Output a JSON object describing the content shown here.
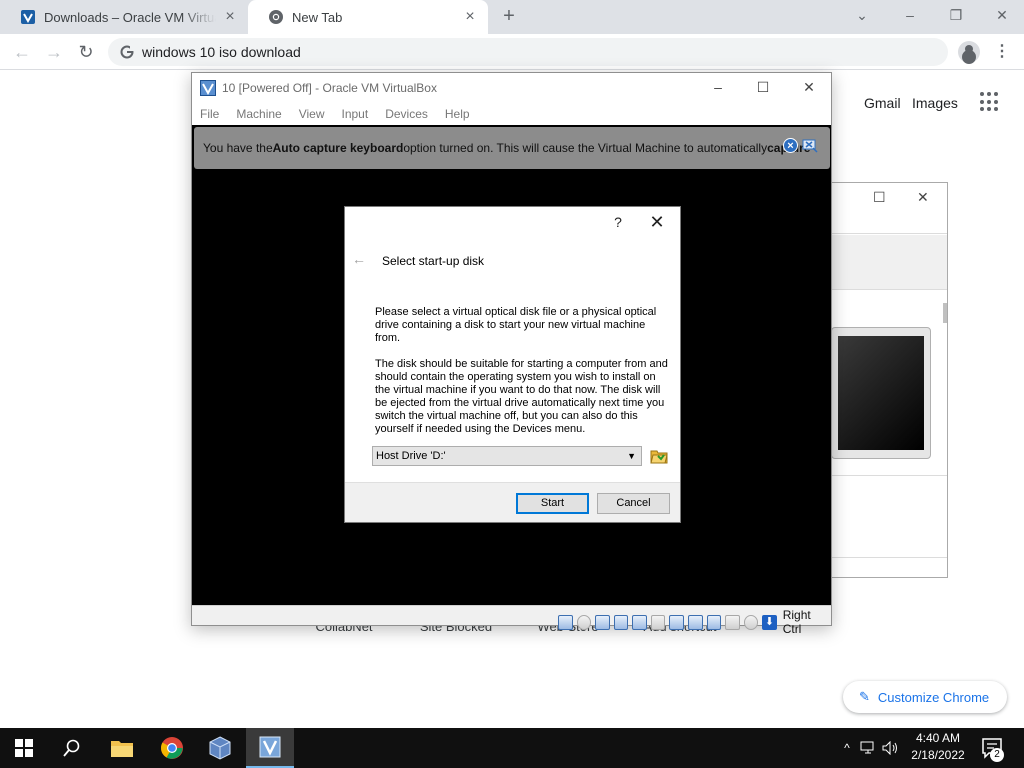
{
  "browser": {
    "tabs": [
      {
        "title": "Downloads – Oracle VM VirtualBox",
        "active": false
      },
      {
        "title": "New Tab",
        "active": true
      }
    ],
    "new_tab_symbol": "+",
    "address": "windows 10 iso download"
  },
  "ntp": {
    "links": [
      "Gmail",
      "Images"
    ],
    "shortcuts": [
      "CollabNet",
      "Site Blocked",
      "Web Store",
      "Add shortcut"
    ],
    "customize_label": "Customize Chrome"
  },
  "vm_window": {
    "title": "10 [Powered Off] - Oracle VM VirtualBox",
    "menu": [
      "File",
      "Machine",
      "View",
      "Input",
      "Devices",
      "Help"
    ],
    "notice": {
      "prefix": "You have the ",
      "bold1": "Auto capture keyboard",
      "middle": " option turned on. This will cause the Virtual Machine to automatically ",
      "bold2": "capture"
    },
    "host_key": "Right Ctrl"
  },
  "dialog": {
    "help": "?",
    "heading": "Select start-up disk",
    "paragraph1": "Please select a virtual optical disk file or a physical optical drive containing a disk to start your new virtual machine from.",
    "paragraph2": "The disk should be suitable for starting a computer from and should contain the operating system you wish to install on the virtual machine if you want to do that now. The disk will be ejected from the virtual drive automatically next time you switch the virtual machine off, but you can also do this yourself if needed using the Devices menu.",
    "selected_drive": "Host Drive 'D:'",
    "start_label": "Start",
    "cancel_label": "Cancel"
  },
  "taskbar": {
    "time": "4:40 AM",
    "date": "2/18/2022",
    "notification_count": "2"
  },
  "colors": {
    "chrome_frame": "#dee1e6",
    "accent_blue": "#1a73e8",
    "vm_notice": "#8c8c8c",
    "taskbar": "#101010"
  }
}
